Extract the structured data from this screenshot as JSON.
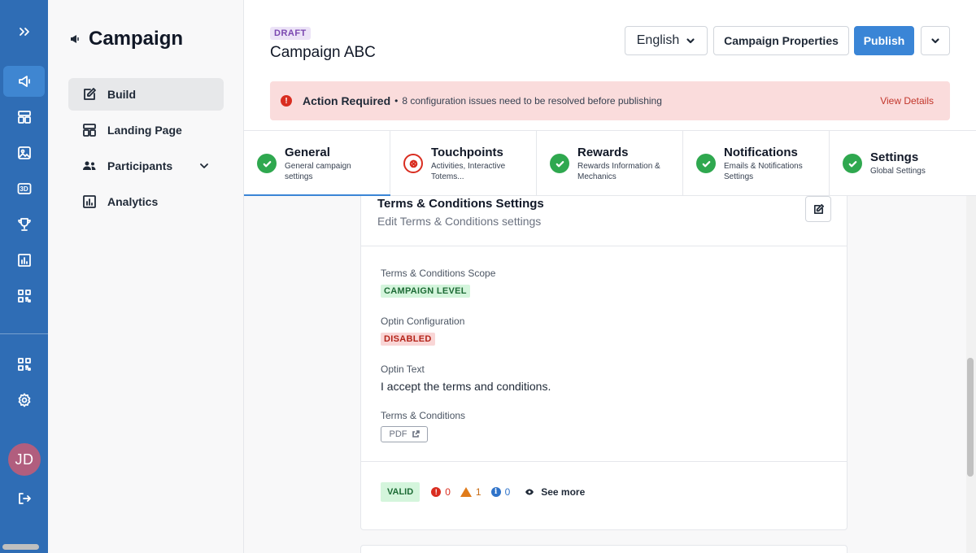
{
  "rail": {
    "avatar_initials": "JD",
    "icons": [
      "expand-icon",
      "megaphone-icon",
      "layout-icon",
      "image-icon",
      "3d-icon",
      "trophy-icon",
      "chart-icon",
      "qr-code-icon",
      "qr-code-icon",
      "gear-icon",
      "logout-icon"
    ],
    "three_d_label": "3D",
    "accent": "#2f6db5"
  },
  "sidenav": {
    "title": "Campaign",
    "items": [
      {
        "label": "Build",
        "icon": "edit-icon",
        "active": true
      },
      {
        "label": "Landing Page",
        "icon": "layout-icon"
      },
      {
        "label": "Participants",
        "icon": "users-icon",
        "expandable": true
      },
      {
        "label": "Analytics",
        "icon": "chart-icon"
      }
    ]
  },
  "header": {
    "status_badge": "DRAFT",
    "campaign_title": "Campaign ABC",
    "language": "English",
    "properties_label": "Campaign Properties",
    "publish_label": "Publish"
  },
  "alert": {
    "heading": "Action Required",
    "separator": "•",
    "message": "8 configuration issues need to be resolved before publishing",
    "link": "View Details"
  },
  "tabs": [
    {
      "title": "General",
      "subtitle": "General campaign settings",
      "status": "ok",
      "active": true
    },
    {
      "title": "Touchpoints",
      "subtitle": "Activities, Interactive Totems...",
      "status": "error"
    },
    {
      "title": "Rewards",
      "subtitle": "Rewards Information & Mechanics",
      "status": "ok"
    },
    {
      "title": "Notifications",
      "subtitle": "Emails & Notifications Settings",
      "status": "ok"
    },
    {
      "title": "Settings",
      "subtitle": "Global Settings",
      "status": "ok"
    }
  ],
  "card": {
    "title": "Terms & Conditions Settings",
    "subtitle": "Edit Terms & Conditions settings",
    "fields": {
      "scope_label": "Terms & Conditions Scope",
      "scope_value": "CAMPAIGN LEVEL",
      "optin_label": "Optin Configuration",
      "optin_value": "DISABLED",
      "optin_text_label": "Optin Text",
      "optin_text_value": "I accept the terms and conditions.",
      "tc_label": "Terms & Conditions",
      "tc_file": "PDF"
    },
    "footer": {
      "status": "VALID",
      "errors": "0",
      "warnings": "1",
      "infos": "0",
      "see_more": "See more"
    }
  }
}
